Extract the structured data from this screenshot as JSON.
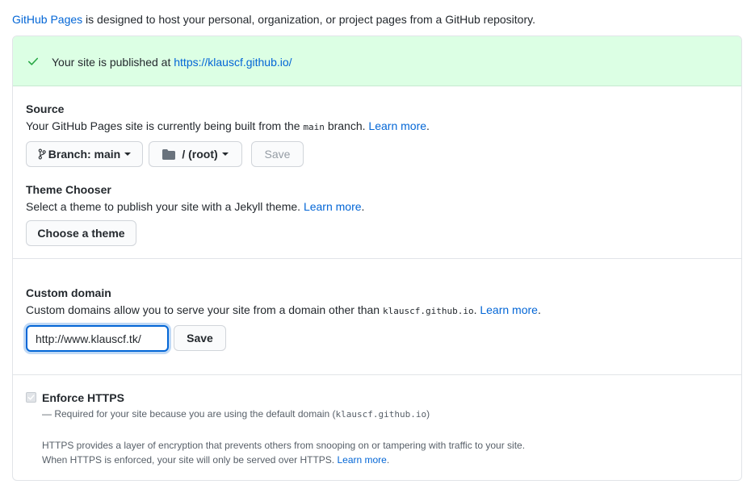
{
  "intro": {
    "link_text": "GitHub Pages",
    "text": " is designed to host your personal, organization, or project pages from a GitHub repository."
  },
  "flash": {
    "icon": "check-icon",
    "message": "Your site is published at ",
    "url": "https://klauscf.github.io/"
  },
  "source": {
    "title": "Source",
    "desc_before": "Your GitHub Pages site is currently being built from the ",
    "branch_code": "main",
    "desc_after": " branch. ",
    "learn_more": "Learn more",
    "period": ".",
    "branch_button": "Branch: main",
    "folder_button": "/ (root)",
    "save_button": "Save"
  },
  "theme": {
    "title": "Theme Chooser",
    "desc": "Select a theme to publish your site with a Jekyll theme. ",
    "learn_more": "Learn more",
    "period": ".",
    "button": "Choose a theme"
  },
  "custom_domain": {
    "title": "Custom domain",
    "desc_before": "Custom domains allow you to serve your site from a domain other than ",
    "domain_code": "klauscf.github.io",
    "desc_after": ". ",
    "learn_more": "Learn more",
    "period": ".",
    "input_value": "http://www.klauscf.tk/",
    "save_button": "Save"
  },
  "https": {
    "title": "Enforce HTTPS",
    "checked": true,
    "note_before": "— Required for your site because you are using the default domain (",
    "note_code": "klauscf.github.io",
    "note_after": ")",
    "info_line1": "HTTPS provides a layer of encryption that prevents others from snooping on or tampering with traffic to your site.",
    "info_line2": "When HTTPS is enforced, your site will only be served over HTTPS. ",
    "learn_more": "Learn more",
    "period": "."
  },
  "colors": {
    "link": "#0366d6",
    "flash_bg": "#dcffe4",
    "success": "#28a745",
    "border": "#e1e4e8"
  }
}
